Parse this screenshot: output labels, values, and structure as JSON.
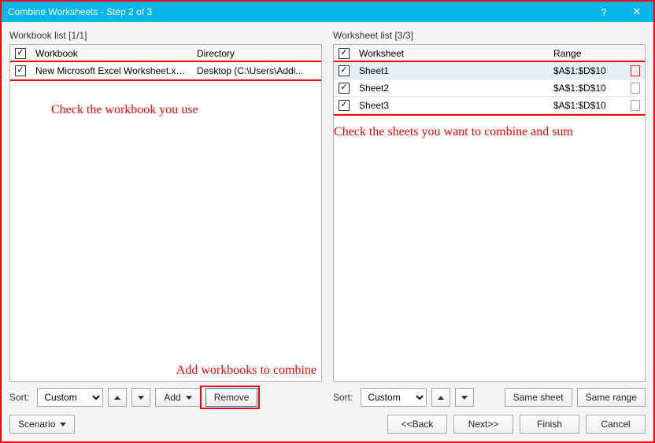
{
  "window": {
    "title": "Combine Worksheets - Step 2 of 3"
  },
  "left": {
    "caption": "Workbook list [1/1]",
    "headers": {
      "name": "Workbook",
      "dir": "Directory"
    },
    "rows": [
      {
        "name": "New Microsoft Excel Worksheet.xlsx",
        "dir": "Desktop (C:\\Users\\Addi..."
      }
    ]
  },
  "right": {
    "caption": "Worksheet list [3/3]",
    "headers": {
      "name": "Worksheet",
      "range": "Range"
    },
    "rows": [
      {
        "name": "Sheet1",
        "range": "$A$1:$D$10"
      },
      {
        "name": "Sheet2",
        "range": "$A$1:$D$10"
      },
      {
        "name": "Sheet3",
        "range": "$A$1:$D$10"
      }
    ]
  },
  "toolbar": {
    "sort_label": "Sort:",
    "sort_value": "Custom",
    "add": "Add",
    "remove": "Remove",
    "same_sheet": "Same sheet",
    "same_range": "Same range"
  },
  "footer": {
    "scenario": "Scenario",
    "back": "<<Back",
    "next": "Next>>",
    "finish": "Finish",
    "cancel": "Cancel"
  },
  "annot": {
    "wb": "Check the workbook you use",
    "add": "Add workbooks to combine",
    "sheets": "Check the sheets you want to combine and sum"
  }
}
